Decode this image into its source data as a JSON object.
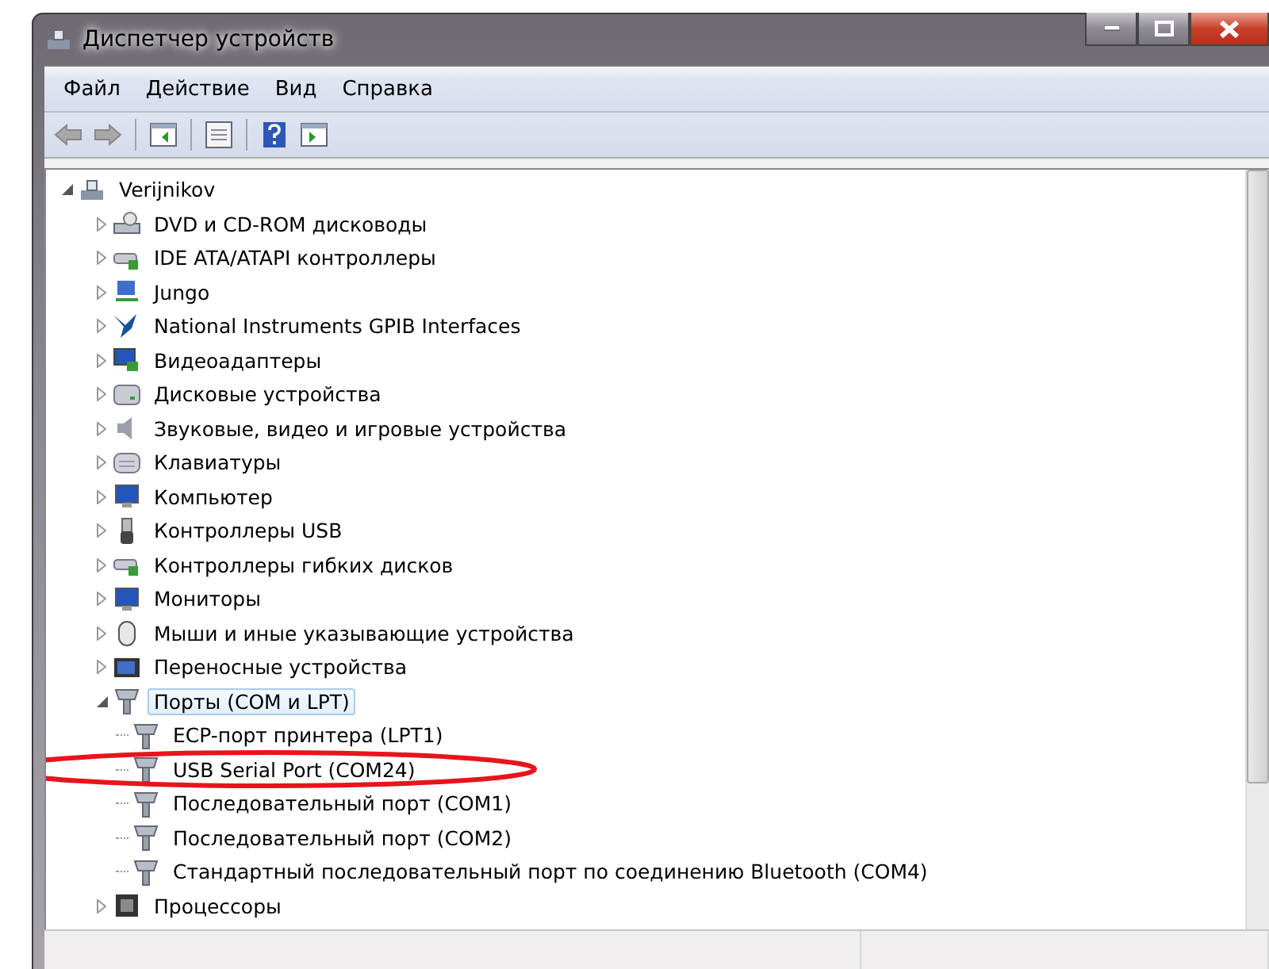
{
  "window": {
    "title": "Диспетчер устройств"
  },
  "menu": [
    "Файл",
    "Действие",
    "Вид",
    "Справка"
  ],
  "toolbar": [
    {
      "kind": "back",
      "disabled": true
    },
    {
      "kind": "forward",
      "disabled": true
    },
    {
      "kind": "separator"
    },
    {
      "kind": "tree-pane"
    },
    {
      "kind": "separator"
    },
    {
      "kind": "properties"
    },
    {
      "kind": "separator"
    },
    {
      "kind": "help"
    },
    {
      "kind": "action-pane"
    }
  ],
  "tree": {
    "label": "Verijnikov",
    "kind": "computer",
    "expanded": true,
    "selected": false,
    "children": [
      {
        "label": "DVD и CD-ROM дисководы",
        "kind": "dvd",
        "expanded": false,
        "selected": false
      },
      {
        "label": "IDE ATA/ATAPI контроллеры",
        "kind": "ide",
        "expanded": false,
        "selected": false
      },
      {
        "label": "Jungo",
        "kind": "network",
        "expanded": false,
        "selected": false
      },
      {
        "label": "National Instruments GPIB Interfaces",
        "kind": "ni",
        "expanded": false,
        "selected": false
      },
      {
        "label": "Видеоадаптеры",
        "kind": "display",
        "expanded": false,
        "selected": false
      },
      {
        "label": "Дисковые устройства",
        "kind": "disk",
        "expanded": false,
        "selected": false
      },
      {
        "label": "Звуковые, видео и игровые устройства",
        "kind": "speaker",
        "expanded": false,
        "selected": false
      },
      {
        "label": "Клавиатуры",
        "kind": "keyboard",
        "expanded": false,
        "selected": false
      },
      {
        "label": "Компьютер",
        "kind": "monitor",
        "expanded": false,
        "selected": false
      },
      {
        "label": "Контроллеры USB",
        "kind": "usb",
        "expanded": false,
        "selected": false
      },
      {
        "label": "Контроллеры гибких дисков",
        "kind": "ide",
        "expanded": false,
        "selected": false
      },
      {
        "label": "Мониторы",
        "kind": "monitor",
        "expanded": false,
        "selected": false
      },
      {
        "label": "Мыши и иные указывающие устройства",
        "kind": "mouse",
        "expanded": false,
        "selected": false
      },
      {
        "label": "Переносные устройства",
        "kind": "portable",
        "expanded": false,
        "selected": false
      },
      {
        "label": "Порты (COM и LPT)",
        "kind": "port",
        "expanded": true,
        "selected": true,
        "children": [
          {
            "label": "ECP-порт принтера (LPT1)",
            "kind": "port",
            "circled": false
          },
          {
            "label": "USB Serial Port (COM24)",
            "kind": "port",
            "circled": true
          },
          {
            "label": "Последовательный порт (COM1)",
            "kind": "port",
            "circled": false
          },
          {
            "label": "Последовательный порт (COM2)",
            "kind": "port",
            "circled": false
          },
          {
            "label": "Стандартный последовательный порт по соединению Bluetooth (COM4)",
            "kind": "port",
            "circled": false
          }
        ]
      },
      {
        "label": "Процессоры",
        "kind": "cpu",
        "expanded": false,
        "selected": false
      }
    ]
  }
}
